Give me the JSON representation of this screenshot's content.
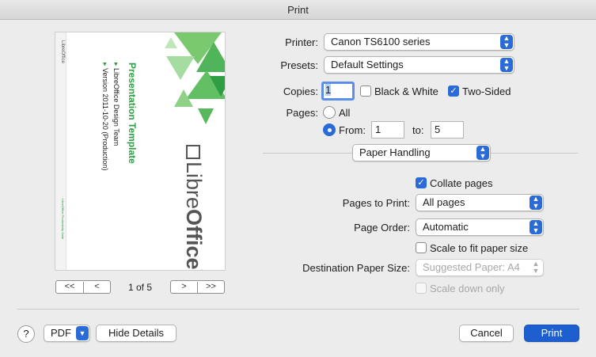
{
  "window": {
    "title": "Print"
  },
  "preview": {
    "logo_libre": "Libre",
    "logo_office": "Office",
    "logo_tm": "®",
    "heading": "Presentation Template",
    "bullet1": "LibreOffice Design Team",
    "bullet2": "Version 2011-10-20 (Production)",
    "side_text": "LibreOffice",
    "footer_text": "LibreOffice Productivity Suite"
  },
  "nav": {
    "first": "<<",
    "prev": "<",
    "next": ">",
    "last": ">>",
    "page_indicator": "1 of 5"
  },
  "printer": {
    "label": "Printer:",
    "value": "Canon TS6100 series"
  },
  "presets": {
    "label": "Presets:",
    "value": "Default Settings"
  },
  "copies": {
    "label": "Copies:",
    "value": "1"
  },
  "black_white": {
    "label": "Black & White",
    "checked": false
  },
  "two_sided": {
    "label": "Two-Sided",
    "checked": true
  },
  "pages": {
    "label": "Pages:",
    "all_label": "All",
    "from_label": "From:",
    "from_value": "1",
    "to_label": "to:",
    "to_value": "5"
  },
  "section": {
    "value": "Paper Handling"
  },
  "collate": {
    "label": "Collate pages",
    "checked": true
  },
  "pages_to_print": {
    "label": "Pages to Print:",
    "value": "All pages"
  },
  "page_order": {
    "label": "Page Order:",
    "value": "Automatic"
  },
  "scale_fit": {
    "label": "Scale to fit paper size",
    "checked": false
  },
  "dest_paper": {
    "label": "Destination Paper Size:",
    "value": "Suggested Paper: A4"
  },
  "scale_down": {
    "label": "Scale down only",
    "checked": false
  },
  "footer": {
    "help": "?",
    "pdf": "PDF",
    "hide_details": "Hide Details",
    "cancel": "Cancel",
    "print": "Print"
  },
  "colors": {
    "accent": "#2a6bd8",
    "green": "#2e9e44"
  }
}
